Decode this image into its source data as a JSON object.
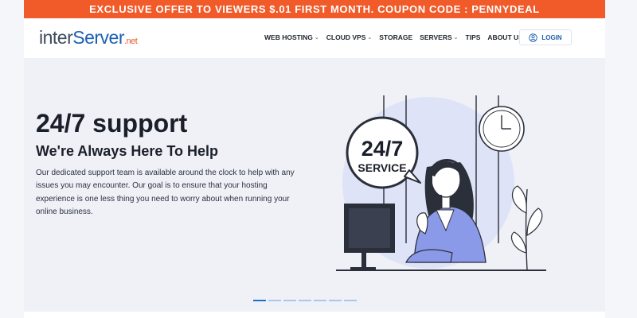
{
  "promo": {
    "text": "EXCLUSIVE OFFER TO VIEWERS $.01 FIRST MONTH. COUPON CODE : PENNYDEAL"
  },
  "logo": {
    "part1": "inter",
    "part2": "Server",
    "part3": ".net"
  },
  "nav": {
    "items": [
      {
        "label": "WEB HOSTING",
        "dropdown": true
      },
      {
        "label": "CLOUD VPS",
        "dropdown": true
      },
      {
        "label": "STORAGE",
        "dropdown": false
      },
      {
        "label": "SERVERS",
        "dropdown": true
      },
      {
        "label": "TIPS",
        "dropdown": false
      },
      {
        "label": "ABOUT US",
        "dropdown": true
      }
    ],
    "login_label": "LOGIN"
  },
  "hero": {
    "title": "24/7 support",
    "subtitle": "We're Always Here To Help",
    "text": "Our dedicated support team is available around the clock to help with any issues you may encounter. Our goal is to ensure that your hosting experience is one less thing you need to worry about when running your online business.",
    "bubble_line1": "24/7",
    "bubble_line2": "SERVICE"
  },
  "carousel": {
    "slide_count": 7,
    "active_index": 0
  },
  "colors": {
    "accent": "#f15a29",
    "brand_blue": "#1c5fb4",
    "active_dot": "#1c6fd1"
  },
  "icons": {
    "login": "user-circle-icon",
    "dropdown": "chevron-down-icon"
  }
}
